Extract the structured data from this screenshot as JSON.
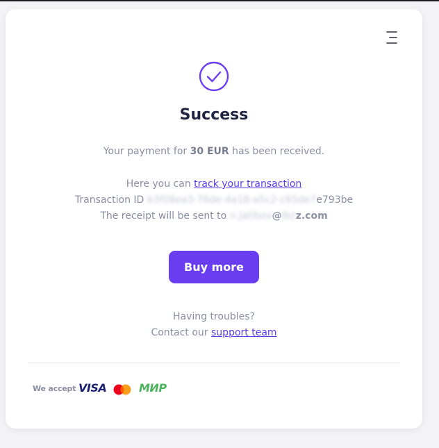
{
  "menu": {
    "icon": "hamburger-menu-icon"
  },
  "status": {
    "icon": "checkmark-circle-icon",
    "title": "Success",
    "accent_color": "#6a3df0"
  },
  "payment": {
    "prefix": "Your payment for",
    "amount": "30 EUR",
    "suffix": "has been received."
  },
  "tracking": {
    "prefix": "Here you can",
    "link_label": "track your transaction"
  },
  "transaction": {
    "label": "Transaction ID",
    "id_hidden": "b3f08ea3-76de-4a18-a5c2-c65de7",
    "id_visible": "e793be"
  },
  "receipt": {
    "label": "The receipt will be sent to",
    "email_hidden": "n.jatibov",
    "email_visible": "@",
    "email_hidden_domain": "lbz",
    "email_visible_domain": "z.com"
  },
  "actions": {
    "buy_more_label": "Buy more"
  },
  "support": {
    "question": "Having troubles?",
    "prefix": "Contact our",
    "link_label": "support team"
  },
  "payment_methods": {
    "label": "We accept",
    "methods": [
      "VISA",
      "mastercard-logo",
      "МИР"
    ]
  }
}
